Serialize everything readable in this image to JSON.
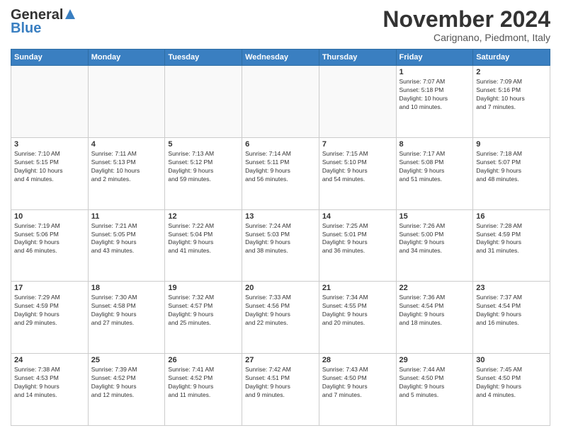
{
  "logo": {
    "line1": "General",
    "line2": "Blue"
  },
  "title": "November 2024",
  "location": "Carignano, Piedmont, Italy",
  "weekdays": [
    "Sunday",
    "Monday",
    "Tuesday",
    "Wednesday",
    "Thursday",
    "Friday",
    "Saturday"
  ],
  "weeks": [
    [
      {
        "day": "",
        "info": ""
      },
      {
        "day": "",
        "info": ""
      },
      {
        "day": "",
        "info": ""
      },
      {
        "day": "",
        "info": ""
      },
      {
        "day": "",
        "info": ""
      },
      {
        "day": "1",
        "info": "Sunrise: 7:07 AM\nSunset: 5:18 PM\nDaylight: 10 hours\nand 10 minutes."
      },
      {
        "day": "2",
        "info": "Sunrise: 7:09 AM\nSunset: 5:16 PM\nDaylight: 10 hours\nand 7 minutes."
      }
    ],
    [
      {
        "day": "3",
        "info": "Sunrise: 7:10 AM\nSunset: 5:15 PM\nDaylight: 10 hours\nand 4 minutes."
      },
      {
        "day": "4",
        "info": "Sunrise: 7:11 AM\nSunset: 5:13 PM\nDaylight: 10 hours\nand 2 minutes."
      },
      {
        "day": "5",
        "info": "Sunrise: 7:13 AM\nSunset: 5:12 PM\nDaylight: 9 hours\nand 59 minutes."
      },
      {
        "day": "6",
        "info": "Sunrise: 7:14 AM\nSunset: 5:11 PM\nDaylight: 9 hours\nand 56 minutes."
      },
      {
        "day": "7",
        "info": "Sunrise: 7:15 AM\nSunset: 5:10 PM\nDaylight: 9 hours\nand 54 minutes."
      },
      {
        "day": "8",
        "info": "Sunrise: 7:17 AM\nSunset: 5:08 PM\nDaylight: 9 hours\nand 51 minutes."
      },
      {
        "day": "9",
        "info": "Sunrise: 7:18 AM\nSunset: 5:07 PM\nDaylight: 9 hours\nand 48 minutes."
      }
    ],
    [
      {
        "day": "10",
        "info": "Sunrise: 7:19 AM\nSunset: 5:06 PM\nDaylight: 9 hours\nand 46 minutes."
      },
      {
        "day": "11",
        "info": "Sunrise: 7:21 AM\nSunset: 5:05 PM\nDaylight: 9 hours\nand 43 minutes."
      },
      {
        "day": "12",
        "info": "Sunrise: 7:22 AM\nSunset: 5:04 PM\nDaylight: 9 hours\nand 41 minutes."
      },
      {
        "day": "13",
        "info": "Sunrise: 7:24 AM\nSunset: 5:03 PM\nDaylight: 9 hours\nand 38 minutes."
      },
      {
        "day": "14",
        "info": "Sunrise: 7:25 AM\nSunset: 5:01 PM\nDaylight: 9 hours\nand 36 minutes."
      },
      {
        "day": "15",
        "info": "Sunrise: 7:26 AM\nSunset: 5:00 PM\nDaylight: 9 hours\nand 34 minutes."
      },
      {
        "day": "16",
        "info": "Sunrise: 7:28 AM\nSunset: 4:59 PM\nDaylight: 9 hours\nand 31 minutes."
      }
    ],
    [
      {
        "day": "17",
        "info": "Sunrise: 7:29 AM\nSunset: 4:59 PM\nDaylight: 9 hours\nand 29 minutes."
      },
      {
        "day": "18",
        "info": "Sunrise: 7:30 AM\nSunset: 4:58 PM\nDaylight: 9 hours\nand 27 minutes."
      },
      {
        "day": "19",
        "info": "Sunrise: 7:32 AM\nSunset: 4:57 PM\nDaylight: 9 hours\nand 25 minutes."
      },
      {
        "day": "20",
        "info": "Sunrise: 7:33 AM\nSunset: 4:56 PM\nDaylight: 9 hours\nand 22 minutes."
      },
      {
        "day": "21",
        "info": "Sunrise: 7:34 AM\nSunset: 4:55 PM\nDaylight: 9 hours\nand 20 minutes."
      },
      {
        "day": "22",
        "info": "Sunrise: 7:36 AM\nSunset: 4:54 PM\nDaylight: 9 hours\nand 18 minutes."
      },
      {
        "day": "23",
        "info": "Sunrise: 7:37 AM\nSunset: 4:54 PM\nDaylight: 9 hours\nand 16 minutes."
      }
    ],
    [
      {
        "day": "24",
        "info": "Sunrise: 7:38 AM\nSunset: 4:53 PM\nDaylight: 9 hours\nand 14 minutes."
      },
      {
        "day": "25",
        "info": "Sunrise: 7:39 AM\nSunset: 4:52 PM\nDaylight: 9 hours\nand 12 minutes."
      },
      {
        "day": "26",
        "info": "Sunrise: 7:41 AM\nSunset: 4:52 PM\nDaylight: 9 hours\nand 11 minutes."
      },
      {
        "day": "27",
        "info": "Sunrise: 7:42 AM\nSunset: 4:51 PM\nDaylight: 9 hours\nand 9 minutes."
      },
      {
        "day": "28",
        "info": "Sunrise: 7:43 AM\nSunset: 4:50 PM\nDaylight: 9 hours\nand 7 minutes."
      },
      {
        "day": "29",
        "info": "Sunrise: 7:44 AM\nSunset: 4:50 PM\nDaylight: 9 hours\nand 5 minutes."
      },
      {
        "day": "30",
        "info": "Sunrise: 7:45 AM\nSunset: 4:50 PM\nDaylight: 9 hours\nand 4 minutes."
      }
    ]
  ]
}
